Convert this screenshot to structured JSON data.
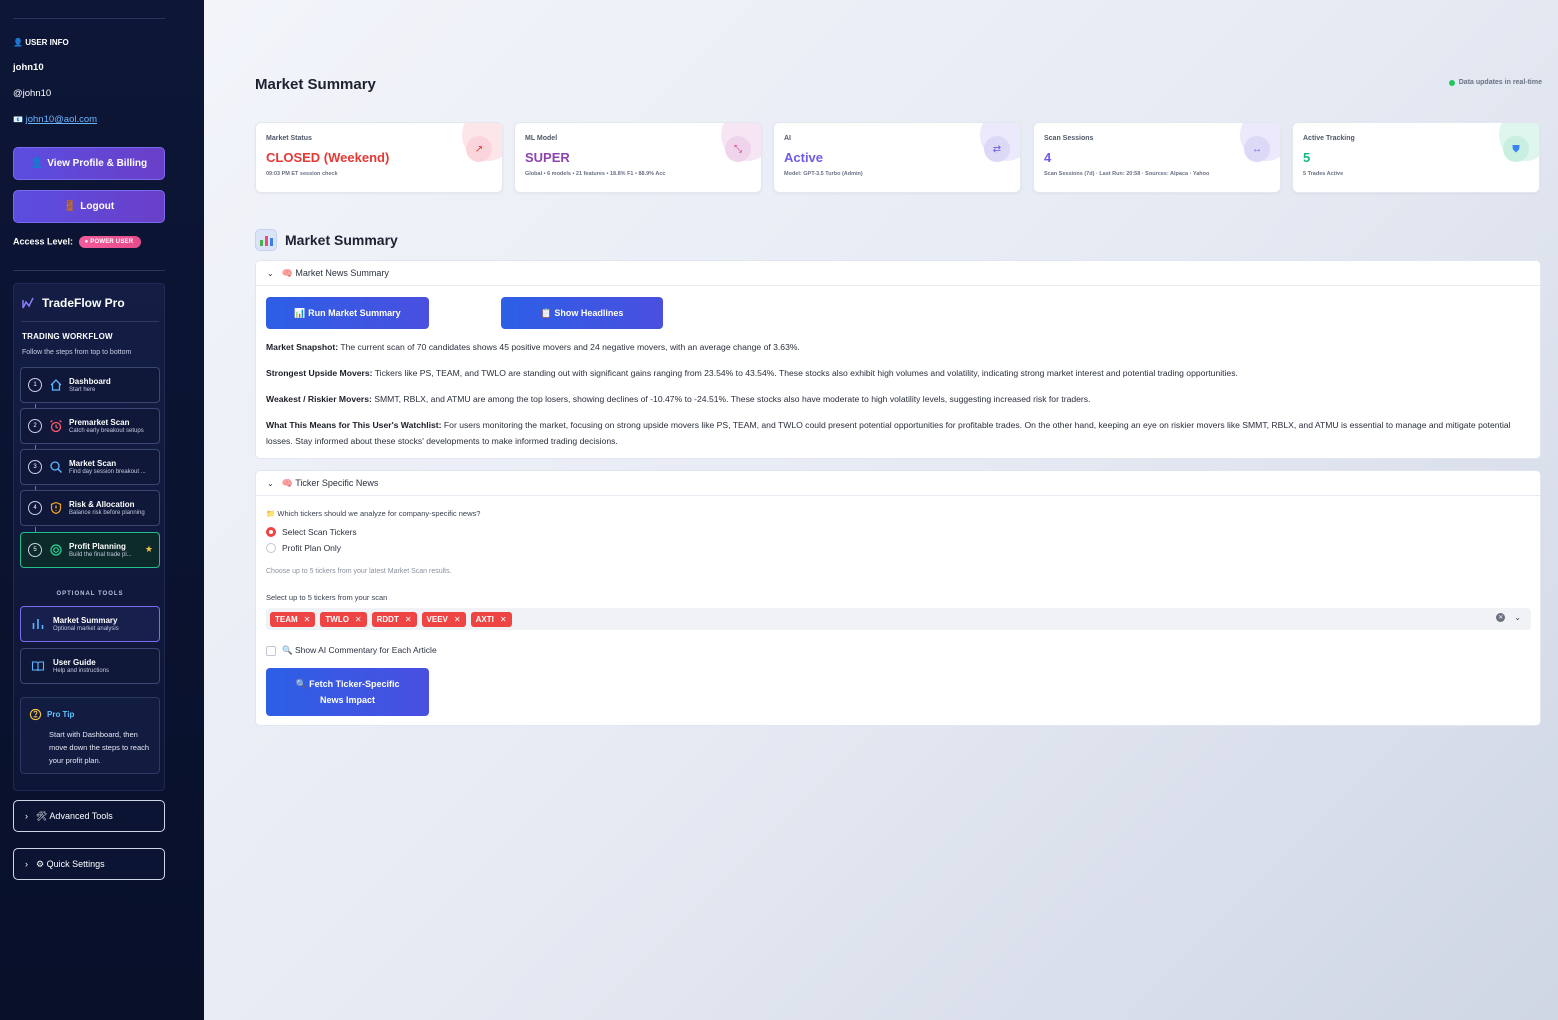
{
  "sidebar": {
    "user_info_label": "USER INFO",
    "username": "john10",
    "handle": "@john10",
    "email": "john10@aol.com",
    "view_profile_label": "View Profile & Billing",
    "logout_label": "Logout",
    "access_level_label": "Access Level:",
    "access_badge": "POWER USER",
    "brand": "TradeFlow Pro",
    "workflow_title": "TRADING WORKFLOW",
    "workflow_subtitle": "Follow the steps from top to bottom",
    "steps": [
      {
        "num": "1",
        "title": "Dashboard",
        "sub": "Start here"
      },
      {
        "num": "2",
        "title": "Premarket Scan",
        "sub": "Catch early breakout setups"
      },
      {
        "num": "3",
        "title": "Market Scan",
        "sub": "Find day session breakout ..."
      },
      {
        "num": "4",
        "title": "Risk & Allocation",
        "sub": "Balance risk before planning"
      },
      {
        "num": "5",
        "title": "Profit Planning",
        "sub": "Build the final trade pl..."
      }
    ],
    "optional_tools_label": "OPTIONAL TOOLS",
    "tools": [
      {
        "title": "Market Summary",
        "sub": "Optional market analysis"
      },
      {
        "title": "User Guide",
        "sub": "Help and instructions"
      }
    ],
    "pro_tip_title": "Pro Tip",
    "pro_tip_text": "Start with Dashboard, then move down the steps to reach your profit plan.",
    "advanced_tools_label": "🛠 Advanced Tools",
    "quick_settings_label": "⚙ Quick Settings"
  },
  "header": {
    "title": "Market Summary",
    "realtime_label": "Data updates in real-time"
  },
  "cards": [
    {
      "label": "Market Status",
      "value": "CLOSED (Weekend)",
      "sub": "09:03 PM ET session check",
      "icon": "↗",
      "value_color": "#e53935"
    },
    {
      "label": "ML Model",
      "value": "SUPER",
      "sub": "Global • 6 models • 21 features • 18.8% F1 • 88.9% Acc",
      "icon": "⤡",
      "value_color": "#8e44ad"
    },
    {
      "label": "AI",
      "value": "Active",
      "sub": "Model: GPT-3.5 Turbo (Admin)",
      "icon": "⇄",
      "value_color": "#6c5ce7"
    },
    {
      "label": "Scan Sessions",
      "value": "4",
      "sub": "Scan Sessions (7d) · Last Run: 20:58 · Sources: Alpaca · Yahoo",
      "icon": "↔",
      "value_color": "#6c5ce7"
    },
    {
      "label": "Active Tracking",
      "value": "5",
      "sub": "5 Trades Active",
      "icon": "⛊",
      "value_color": "#10b981"
    }
  ],
  "section": {
    "title": "Market Summary"
  },
  "news_panel": {
    "header": "🧠 Market News Summary",
    "run_label": "📊 Run Market Summary",
    "headlines_label": "📋 Show Headlines",
    "paragraphs": [
      {
        "lead": "Market Snapshot:",
        "text": " The current scan of 70 candidates shows 45 positive movers and 24 negative movers, with an average change of 3.63%."
      },
      {
        "lead": "Strongest Upside Movers:",
        "text": " Tickers like PS, TEAM, and TWLO are standing out with significant gains ranging from 23.54% to 43.54%. These stocks also exhibit high volumes and volatility, indicating strong market interest and potential trading opportunities."
      },
      {
        "lead": "Weakest / Riskier Movers:",
        "text": " SMMT, RBLX, and ATMU are among the top losers, showing declines of -10.47% to -24.51%. These stocks also have moderate to high volatility levels, suggesting increased risk for traders."
      },
      {
        "lead": "What This Means for This User's Watchlist:",
        "text": " For users monitoring the market, focusing on strong upside movers like PS, TEAM, and TWLO could present potential opportunities for profitable trades. On the other hand, keeping an eye on riskier movers like SMMT, RBLX, and ATMU is essential to manage and mitigate potential losses. Stay informed about these stocks' developments to make informed trading decisions."
      }
    ]
  },
  "ticker_panel": {
    "header": "🧠 Ticker Specific News",
    "question": "📁 Which tickers should we analyze for company-specific news?",
    "option_scan": "Select Scan Tickers",
    "option_profit": "Profit Plan Only",
    "hint": "Choose up to 5 tickers from your latest Market Scan results.",
    "select_label": "Select up to 5 tickers from your scan",
    "tags": [
      "TEAM",
      "TWLO",
      "RDDT",
      "VEEV",
      "AXTI"
    ],
    "commentary_label": "🔍 Show AI Commentary for Each Article",
    "fetch_label": "🔍 Fetch Ticker-Specific News Impact"
  }
}
